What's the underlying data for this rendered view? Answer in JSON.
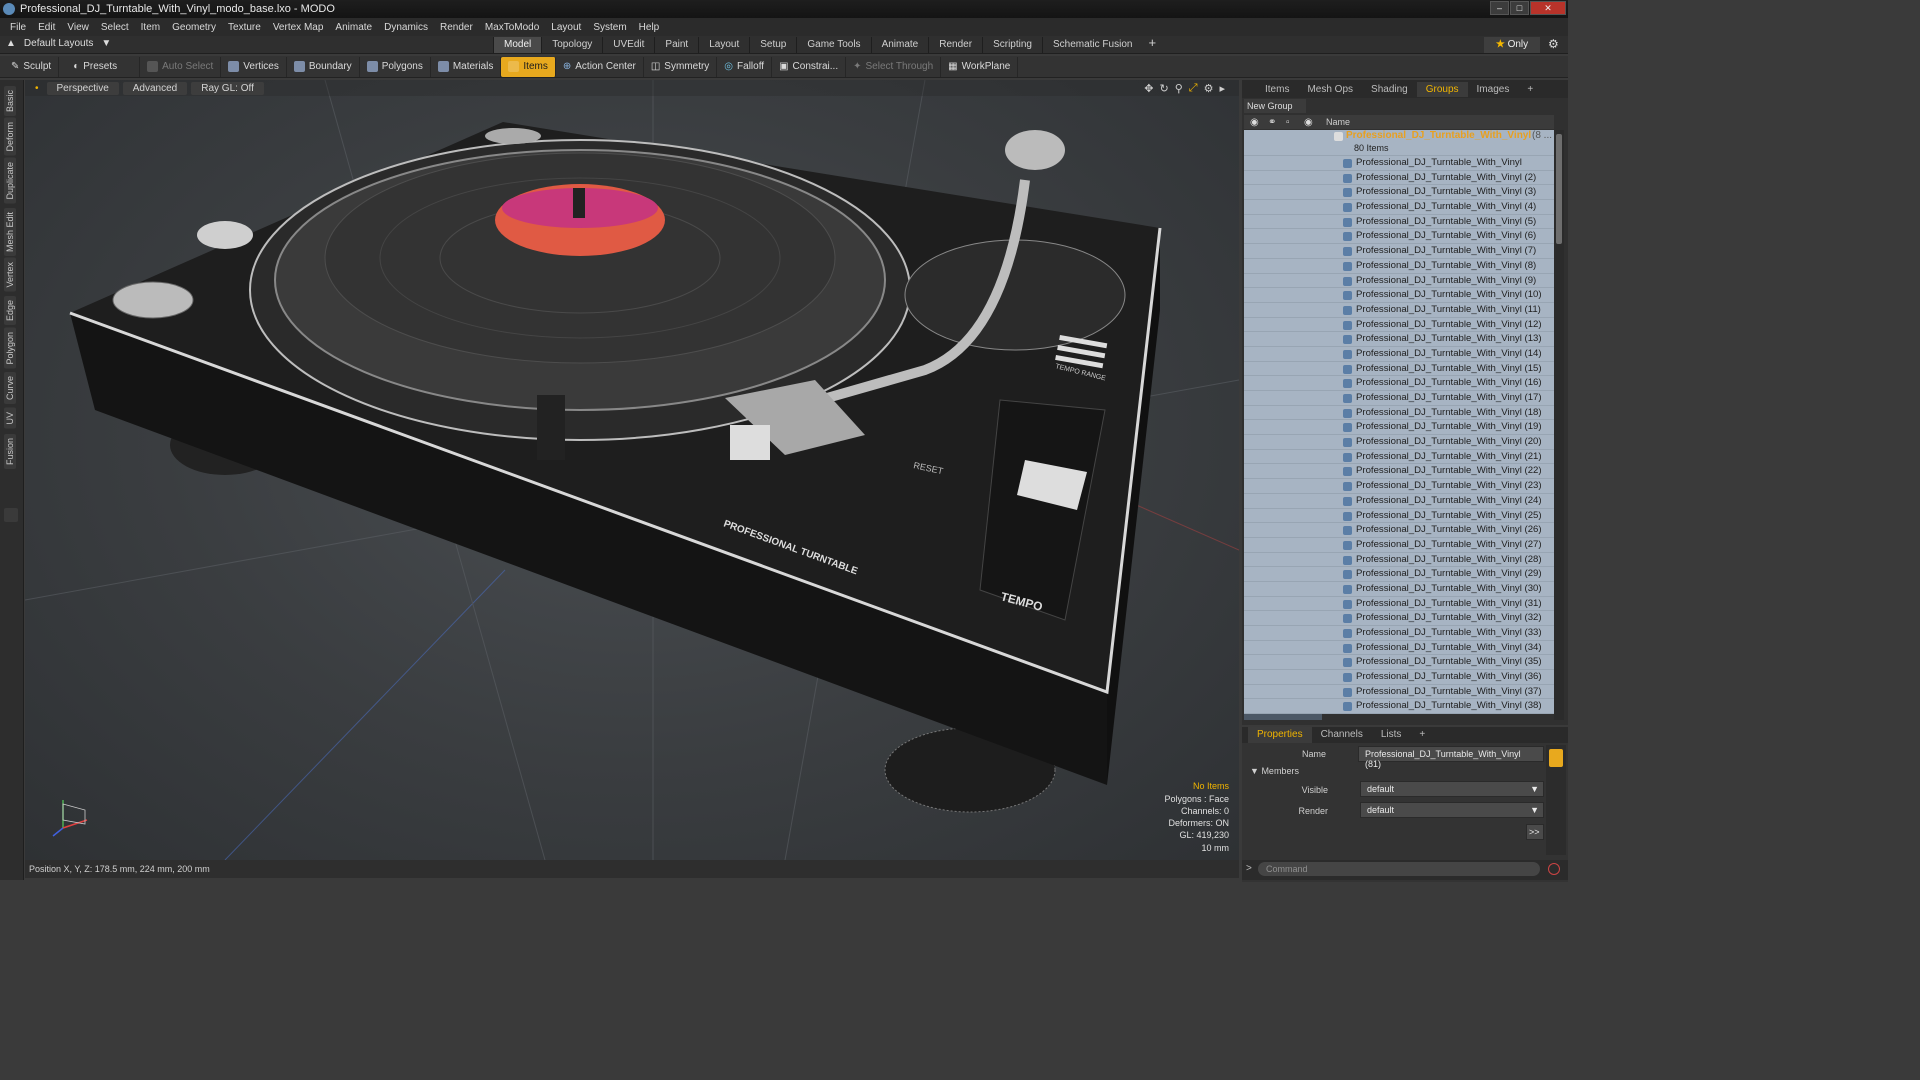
{
  "window": {
    "title": "Professional_DJ_Turntable_With_Vinyl_modo_base.lxo - MODO"
  },
  "menu": [
    "File",
    "Edit",
    "View",
    "Select",
    "Item",
    "Geometry",
    "Texture",
    "Vertex Map",
    "Animate",
    "Dynamics",
    "Render",
    "MaxToModo",
    "Layout",
    "System",
    "Help"
  ],
  "layout": {
    "default_layouts": "Default Layouts",
    "tabs": [
      "Model",
      "Topology",
      "UVEdit",
      "Paint",
      "Layout",
      "Setup",
      "Game Tools",
      "Animate",
      "Render",
      "Scripting",
      "Schematic Fusion"
    ],
    "active_tab": "Model",
    "only_label": "Only"
  },
  "toolbar": {
    "sculpt": "Sculpt",
    "presets": "Presets",
    "auto_select": "Auto Select",
    "vertices": "Vertices",
    "boundary": "Boundary",
    "polygons": "Polygons",
    "materials": "Materials",
    "items": "Items",
    "action_center": "Action Center",
    "symmetry": "Symmetry",
    "falloff": "Falloff",
    "constrain": "Constrai...",
    "select_through": "Select Through",
    "workplane": "WorkPlane"
  },
  "left_tabs": [
    "Basic",
    "Deform",
    "Duplicate",
    "Mesh Edit",
    "Vertex",
    "Edge",
    "Polygon",
    "Curve",
    "UV",
    "Fusion"
  ],
  "viewport": {
    "view": "Perspective",
    "shading": "Advanced",
    "raygl": "Ray GL: Off",
    "status": [
      "No Items",
      "Polygons : Face",
      "Channels: 0",
      "Deformers: ON",
      "GL: 419,230",
      "10 mm"
    ],
    "position": "Position X, Y, Z:   178.5 mm, 224 mm, 200 mm",
    "labels": {
      "brand": "PROFESSIONAL TURNTABLE",
      "tempo": "TEMPO",
      "reset": "RESET",
      "tempo_range": "TEMPO RANGE"
    }
  },
  "right_panel": {
    "tabs": [
      "Items",
      "Mesh Ops",
      "Shading",
      "Groups",
      "Images"
    ],
    "active_tab": "Groups",
    "new_group": "New Group",
    "column_name": "Name",
    "group_name": "Professional_DJ_Turntable_With_Vinyl",
    "group_suffix": "(8 ...",
    "group_count": "80 Items",
    "items": [
      "Professional_DJ_Turntable_With_Vinyl",
      "Professional_DJ_Turntable_With_Vinyl (2)",
      "Professional_DJ_Turntable_With_Vinyl (3)",
      "Professional_DJ_Turntable_With_Vinyl (4)",
      "Professional_DJ_Turntable_With_Vinyl (5)",
      "Professional_DJ_Turntable_With_Vinyl (6)",
      "Professional_DJ_Turntable_With_Vinyl (7)",
      "Professional_DJ_Turntable_With_Vinyl (8)",
      "Professional_DJ_Turntable_With_Vinyl (9)",
      "Professional_DJ_Turntable_With_Vinyl (10)",
      "Professional_DJ_Turntable_With_Vinyl (11)",
      "Professional_DJ_Turntable_With_Vinyl (12)",
      "Professional_DJ_Turntable_With_Vinyl (13)",
      "Professional_DJ_Turntable_With_Vinyl (14)",
      "Professional_DJ_Turntable_With_Vinyl (15)",
      "Professional_DJ_Turntable_With_Vinyl (16)",
      "Professional_DJ_Turntable_With_Vinyl (17)",
      "Professional_DJ_Turntable_With_Vinyl (18)",
      "Professional_DJ_Turntable_With_Vinyl (19)",
      "Professional_DJ_Turntable_With_Vinyl (20)",
      "Professional_DJ_Turntable_With_Vinyl (21)",
      "Professional_DJ_Turntable_With_Vinyl (22)",
      "Professional_DJ_Turntable_With_Vinyl (23)",
      "Professional_DJ_Turntable_With_Vinyl (24)",
      "Professional_DJ_Turntable_With_Vinyl (25)",
      "Professional_DJ_Turntable_With_Vinyl (26)",
      "Professional_DJ_Turntable_With_Vinyl (27)",
      "Professional_DJ_Turntable_With_Vinyl (28)",
      "Professional_DJ_Turntable_With_Vinyl (29)",
      "Professional_DJ_Turntable_With_Vinyl (30)",
      "Professional_DJ_Turntable_With_Vinyl (31)",
      "Professional_DJ_Turntable_With_Vinyl (32)",
      "Professional_DJ_Turntable_With_Vinyl (33)",
      "Professional_DJ_Turntable_With_Vinyl (34)",
      "Professional_DJ_Turntable_With_Vinyl (35)",
      "Professional_DJ_Turntable_With_Vinyl (36)",
      "Professional_DJ_Turntable_With_Vinyl (37)",
      "Professional_DJ_Turntable_With_Vinyl (38)"
    ]
  },
  "properties": {
    "tabs": [
      "Properties",
      "Channels",
      "Lists"
    ],
    "active_tab": "Properties",
    "name_label": "Name",
    "name_value": "Professional_DJ_Turntable_With_Vinyl (81)",
    "members_label": "Members",
    "visible_label": "Visible",
    "visible_value": "default",
    "render_label": "Render",
    "render_value": "default",
    "more": ">>"
  },
  "command": {
    "placeholder": "Command",
    "prompt": ">"
  },
  "colors": {
    "accent": "#e8a91e",
    "selection_rows": "#a7b4c3",
    "group_name": "#e8a020"
  }
}
